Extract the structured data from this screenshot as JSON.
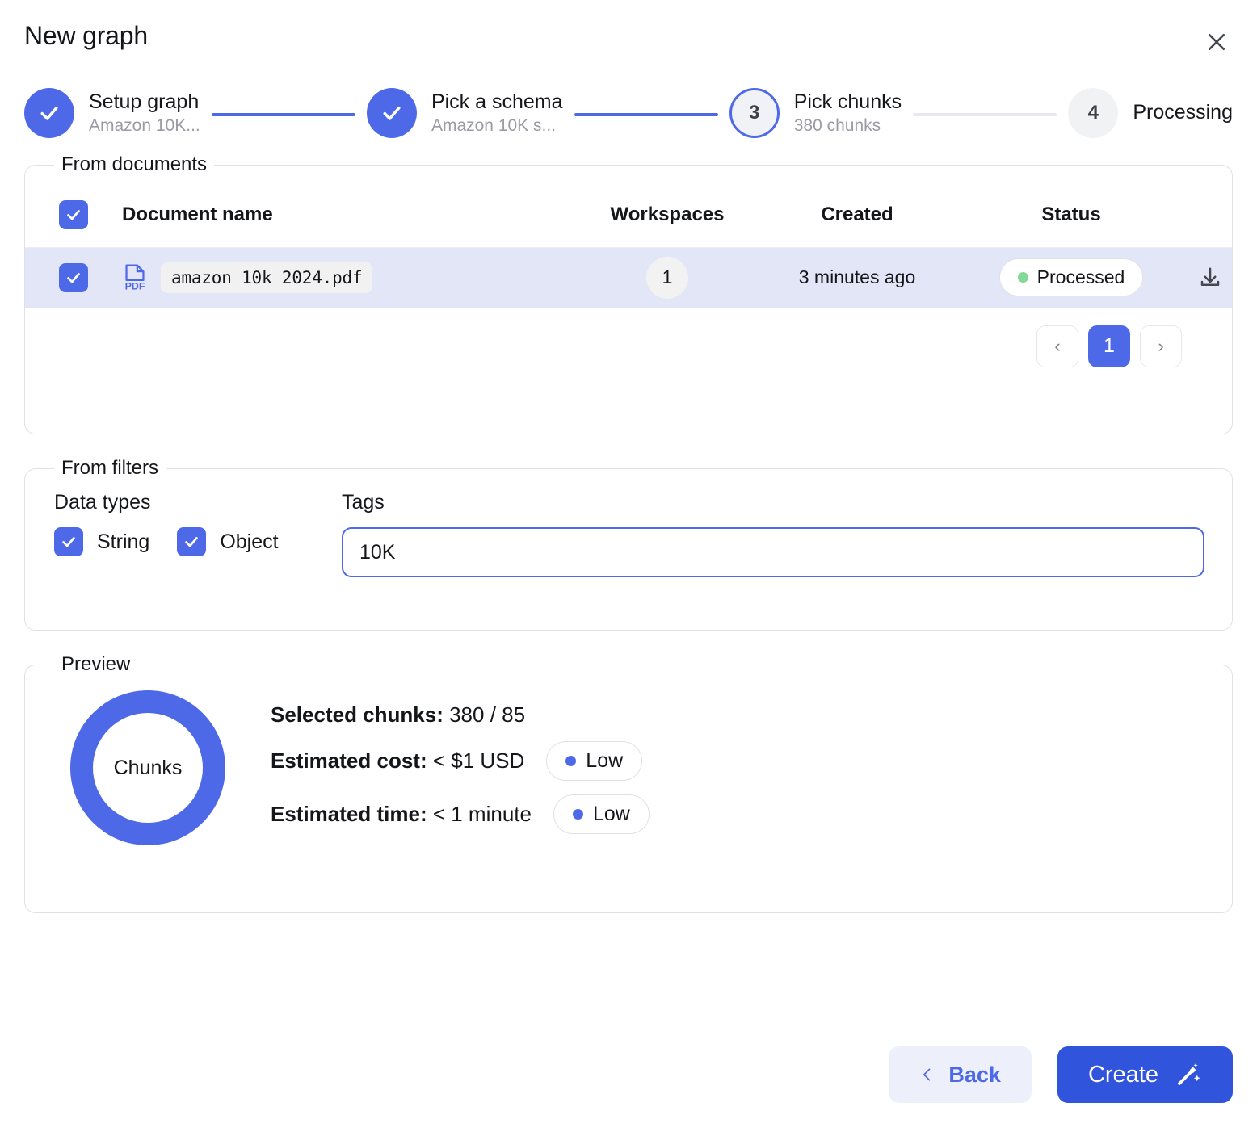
{
  "modal": {
    "title": "New graph",
    "close_label": "close-icon"
  },
  "stepper": {
    "steps": [
      {
        "state": "done",
        "marker": "check",
        "label": "Setup graph",
        "sub": "Amazon 10K..."
      },
      {
        "state": "done",
        "marker": "check",
        "label": "Pick a schema",
        "sub": "Amazon 10K s..."
      },
      {
        "state": "current",
        "marker": "3",
        "label": "Pick chunks",
        "sub": "380 chunks"
      },
      {
        "state": "upcoming",
        "marker": "4",
        "label": "Processing",
        "sub": ""
      }
    ],
    "connectors": [
      "active",
      "active",
      "inactive"
    ]
  },
  "documents": {
    "legend": "From documents",
    "select_all_checked": true,
    "columns": {
      "name": "Document name",
      "workspaces": "Workspaces",
      "created": "Created",
      "status": "Status"
    },
    "rows": [
      {
        "checked": true,
        "file_type": "PDF",
        "name": "amazon_10k_2024.pdf",
        "workspaces": "1",
        "created": "3 minutes ago",
        "status": "Processed",
        "status_color": "#86d898",
        "download_label": "download-icon"
      }
    ],
    "pagination": {
      "prev": "‹",
      "current_page": "1",
      "next": "›"
    }
  },
  "filters": {
    "legend": "From filters",
    "data_types_label": "Data types",
    "data_types": [
      {
        "label": "String",
        "checked": true
      },
      {
        "label": "Object",
        "checked": true
      }
    ],
    "tags_label": "Tags",
    "tags_value": "10K",
    "tags_placeholder": "Tags"
  },
  "preview": {
    "legend": "Preview",
    "donut_label": "Chunks",
    "donut_percent": 100,
    "stats": [
      {
        "label": "Selected chunks:",
        "value": "380 / 85",
        "badge": ""
      },
      {
        "label": "Estimated cost:",
        "value": "< $1 USD",
        "badge": "Low"
      },
      {
        "label": "Estimated time:",
        "value": "< 1 minute",
        "badge": "Low"
      }
    ]
  },
  "footer": {
    "back_label": "Back",
    "create_label": "Create"
  },
  "colors": {
    "brand": "#4e69e8",
    "brand_dark": "#3154dd",
    "row_highlight": "#e3e6f7",
    "status_green": "#86d898",
    "border": "#dfe1e8"
  }
}
